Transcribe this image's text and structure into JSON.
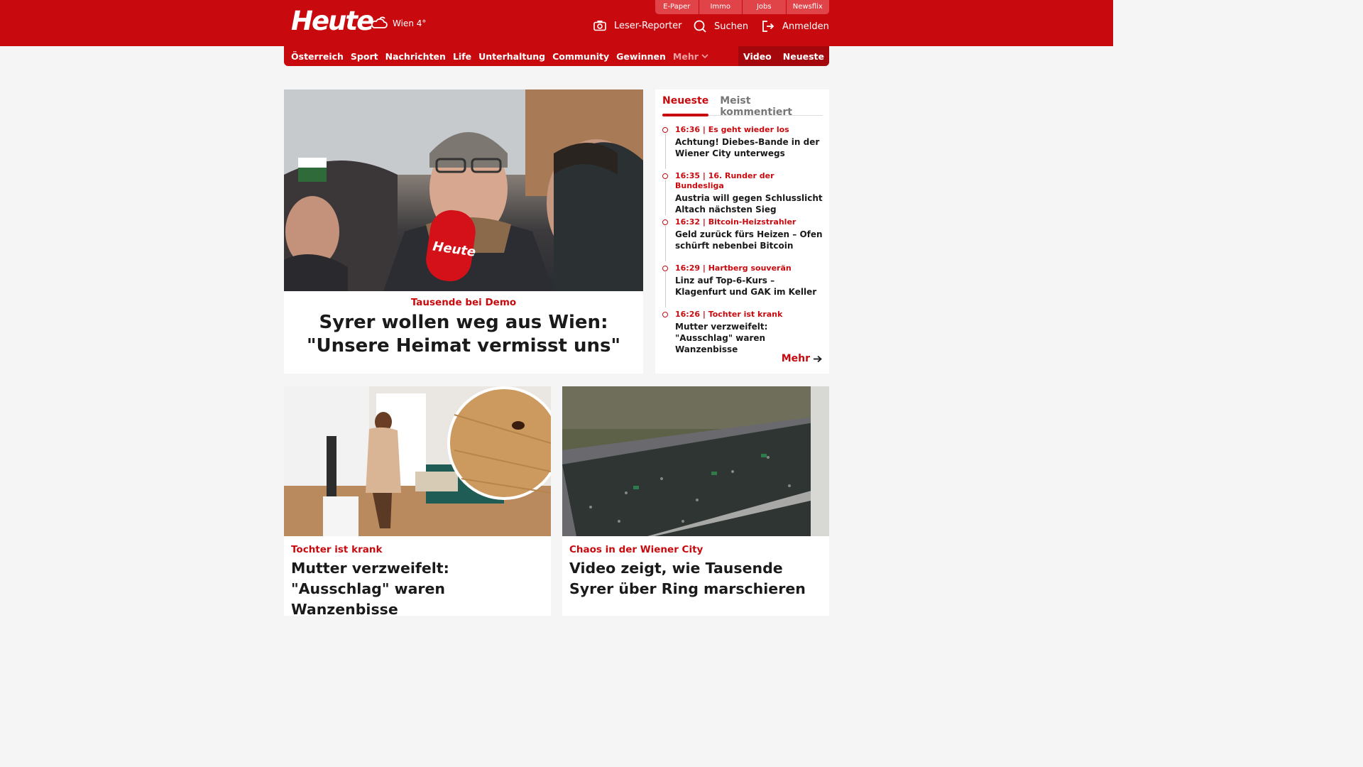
{
  "header": {
    "logo": "Heute",
    "weather": "Wien 4°",
    "top_links": [
      "E-Paper",
      "Immo",
      "Jobs",
      "Newsflix"
    ],
    "reporter": "Leser-Reporter",
    "search": "Suchen",
    "login": "Anmelden"
  },
  "nav": {
    "items": [
      "Österreich",
      "Sport",
      "Nachrichten",
      "Life",
      "Unterhaltung",
      "Community",
      "Gewinnen"
    ],
    "more": "Mehr",
    "video": "Video",
    "latest": "Neueste"
  },
  "hero": {
    "mic_logo": "Heute",
    "kicker": "Tausende bei Demo",
    "headline": "Syrer wollen weg aus Wien: \"Unsere Heimat vermisst uns\""
  },
  "sidebar": {
    "tabs": [
      "Neueste",
      "Meist kommentiert"
    ],
    "news": [
      {
        "meta": "16:36 | Es geht wieder los",
        "title": "Achtung! Diebes-Bande in der Wiener City unterwegs"
      },
      {
        "meta": "16:35 | 16. Runder der Bundesliga",
        "title": "Austria will gegen Schlusslicht Altach nächsten Sieg"
      },
      {
        "meta": "16:32 | Bitcoin-Heizstrahler",
        "title": "Geld zurück fürs Heizen – Ofen schürft nebenbei Bitcoin"
      },
      {
        "meta": "16:29 | Hartberg souverän",
        "title": "Linz auf Top-6-Kurs – Klagenfurt und GAK im Keller"
      },
      {
        "meta": "16:26 | Tochter ist krank",
        "title": "Mutter verzweifelt: \"Ausschlag\" waren Wanzenbisse"
      }
    ],
    "more": "Mehr"
  },
  "cards": [
    {
      "kicker": "Tochter ist krank",
      "headline": "Mutter verzweifelt: \"Ausschlag\" waren Wanzenbisse"
    },
    {
      "kicker": "Chaos in der Wiener City",
      "headline": "Video zeigt, wie Tausende Syrer über Ring marschieren"
    }
  ],
  "colors": {
    "brand": "#c80a0f",
    "background": "#f5f5f5"
  }
}
